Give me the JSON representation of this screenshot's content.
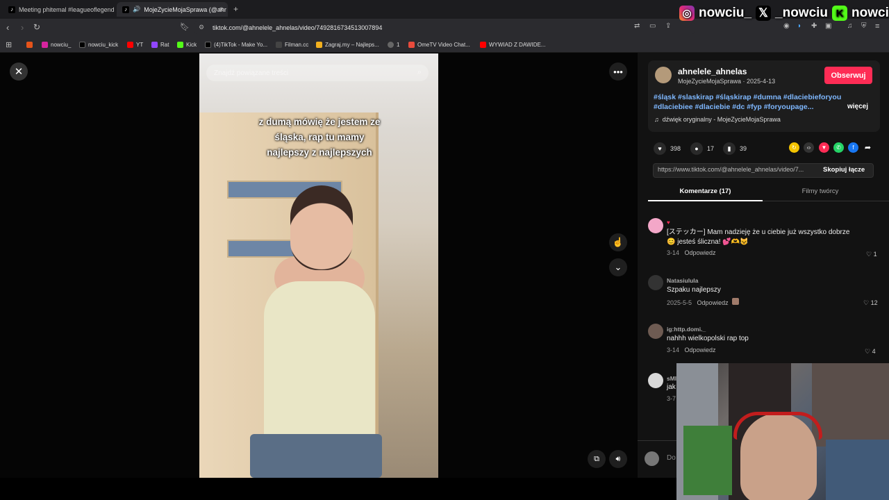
{
  "browser": {
    "tabs": [
      {
        "title": "Meeting phitemal #leagueoflegends"
      },
      {
        "title": "MojeZycieMojaSprawa (@ahr",
        "close": "×"
      }
    ],
    "new_tab": "+",
    "url": "tiktok.com/@ahnelele_ahnelas/video/7492816734513007894",
    "bookmarks": [
      {
        "label": "",
        "color": "#e5531a"
      },
      {
        "label": "nowciu_",
        "color": "#d6249f"
      },
      {
        "label": "nowciu_kick",
        "color": "#000000"
      },
      {
        "label": "YT",
        "color": "#ff0000"
      },
      {
        "label": "Rat",
        "color": "#9146ff"
      },
      {
        "label": "Kick",
        "color": "#53fc18"
      },
      {
        "label": "(4)TikTok - Make Yo...",
        "color": "#000000"
      },
      {
        "label": "Filman.cc",
        "color": "#444444"
      },
      {
        "label": "Zagraj.my – Najleps...",
        "color": "#f2b01e"
      },
      {
        "label": "1",
        "color": "#666666"
      },
      {
        "label": "OmeTV Video Chat...",
        "color": "#e84b3c"
      },
      {
        "label": "WYWIAD Z DAWIDE...",
        "color": "#ff0000"
      }
    ]
  },
  "overlay": {
    "instagram": "nowciu_",
    "x": "_nowciu",
    "kick": "nowciu",
    "kick_letter": "K"
  },
  "video": {
    "search_placeholder": "Znajdź powiązane treści",
    "caption": "z dumą mówię że jestem ze śląska, rap tu mamy najlepszy z najlepszych"
  },
  "post": {
    "username": "ahnelele_ahnelas",
    "nickname": "MojeZycieMojaSprawa",
    "date": "2025-4-13",
    "separator": " · ",
    "follow_label": "Obserwuj",
    "hashtags_line1": "#śląsk #slaskirap #śląskirap #dumna #dlaciebieforyou",
    "hashtags_line2": "#dlaciebiee #dlaciebie #dc #fyp #foryoupage...",
    "more_label": "więcej",
    "sound": "dźwięk oryginalny - MojeZycieMojaSprawa",
    "likes": "398",
    "comments": "17",
    "saves": "39",
    "link": "https://www.tiktok.com/@ahnelele_ahnelas/video/7...",
    "copy_label": "Skopiuj łącze"
  },
  "tabs": {
    "comments": "Komentarze (17)",
    "creator": "Filmy twórcy"
  },
  "comments": [
    {
      "name": "",
      "text": "[ステッカー] Mam nadzieję że u ciebie już wszystko dobrze😊 jesteś śliczna! 💕🫶😺",
      "date": "3-14",
      "reply": "Odpowiedz",
      "likes": "1"
    },
    {
      "name": "Natasiulula",
      "text": "Szpaku najlepszy",
      "date": "2025-5-5",
      "reply": "Odpowiedz",
      "likes": "12"
    },
    {
      "name": "ig:http.domi._",
      "text": "nahhh wielkopolski rap top",
      "date": "3-14",
      "reply": "Odpowiedz",
      "likes": "4"
    },
    {
      "name": "sMl",
      "text": "jak",
      "date": "3-7",
      "reply": "",
      "likes": ""
    }
  ],
  "add_comment_placeholder": "Do"
}
